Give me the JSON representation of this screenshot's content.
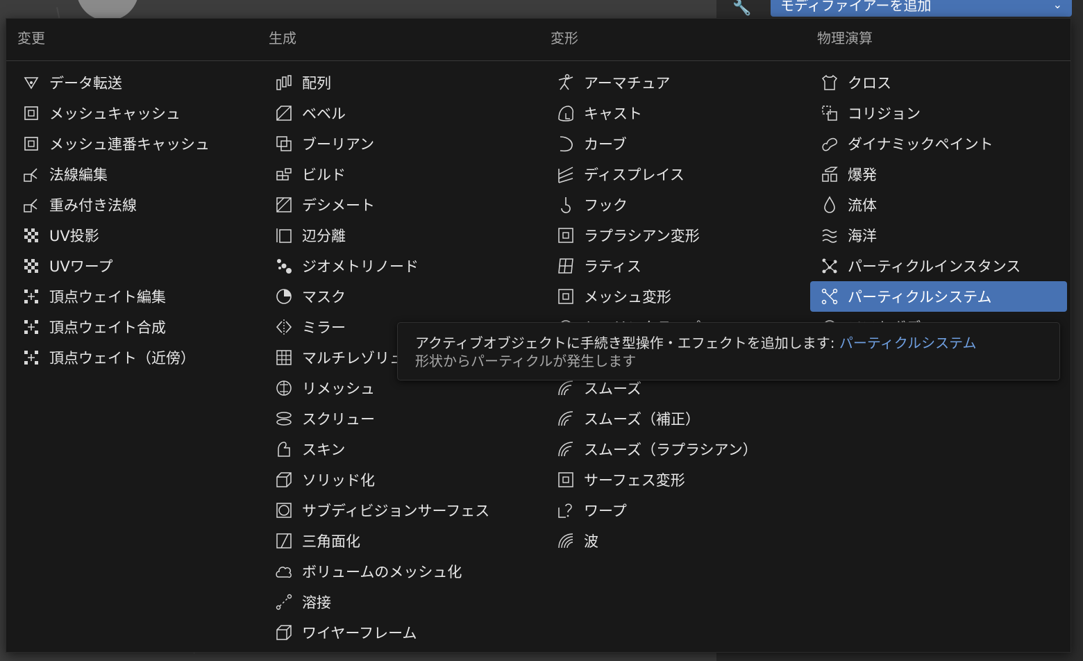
{
  "header_dropdown": {
    "label": "モディファイアーを追加"
  },
  "columns": [
    {
      "title": "変更",
      "items": [
        {
          "label": "データ転送",
          "icon": "data-transfer-icon"
        },
        {
          "label": "メッシュキャッシュ",
          "icon": "mesh-cache-icon"
        },
        {
          "label": "メッシュ連番キャッシュ",
          "icon": "mesh-sequence-cache-icon"
        },
        {
          "label": "法線編集",
          "icon": "normal-edit-icon"
        },
        {
          "label": "重み付き法線",
          "icon": "weighted-normal-icon"
        },
        {
          "label": "UV投影",
          "icon": "uv-project-icon"
        },
        {
          "label": "UVワープ",
          "icon": "uv-warp-icon"
        },
        {
          "label": "頂点ウェイト編集",
          "icon": "vertex-weight-icon"
        },
        {
          "label": "頂点ウェイト合成",
          "icon": "vertex-weight-icon"
        },
        {
          "label": "頂点ウェイト（近傍）",
          "icon": "vertex-weight-icon"
        }
      ]
    },
    {
      "title": "生成",
      "items": [
        {
          "label": "配列",
          "icon": "array-icon"
        },
        {
          "label": "ベベル",
          "icon": "bevel-icon"
        },
        {
          "label": "ブーリアン",
          "icon": "boolean-icon"
        },
        {
          "label": "ビルド",
          "icon": "build-icon"
        },
        {
          "label": "デシメート",
          "icon": "decimate-icon"
        },
        {
          "label": "辺分離",
          "icon": "edge-split-icon"
        },
        {
          "label": "ジオメトリノード",
          "icon": "geometry-nodes-icon"
        },
        {
          "label": "マスク",
          "icon": "mask-icon"
        },
        {
          "label": "ミラー",
          "icon": "mirror-icon"
        },
        {
          "label": "マルチレゾリューション",
          "icon": "multires-icon"
        },
        {
          "label": "リメッシュ",
          "icon": "remesh-icon"
        },
        {
          "label": "スクリュー",
          "icon": "screw-icon"
        },
        {
          "label": "スキン",
          "icon": "skin-icon"
        },
        {
          "label": "ソリッド化",
          "icon": "solidify-icon"
        },
        {
          "label": "サブディビジョンサーフェス",
          "icon": "subdivision-icon"
        },
        {
          "label": "三角面化",
          "icon": "triangulate-icon"
        },
        {
          "label": "ボリュームのメッシュ化",
          "icon": "volume-to-mesh-icon"
        },
        {
          "label": "溶接",
          "icon": "weld-icon"
        },
        {
          "label": "ワイヤーフレーム",
          "icon": "wireframe-icon"
        }
      ]
    },
    {
      "title": "変形",
      "items": [
        {
          "label": "アーマチュア",
          "icon": "armature-icon"
        },
        {
          "label": "キャスト",
          "icon": "cast-icon"
        },
        {
          "label": "カーブ",
          "icon": "curve-icon"
        },
        {
          "label": "ディスプレイス",
          "icon": "displace-icon"
        },
        {
          "label": "フック",
          "icon": "hook-icon"
        },
        {
          "label": "ラプラシアン変形",
          "icon": "laplacian-deform-icon"
        },
        {
          "label": "ラティス",
          "icon": "lattice-icon"
        },
        {
          "label": "メッシュ変形",
          "icon": "mesh-deform-icon"
        },
        {
          "label": "シュリンクラップ",
          "icon": "shrinkwrap-icon"
        },
        {
          "label": "",
          "icon": ""
        },
        {
          "label": "スムーズ",
          "icon": "smooth-icon"
        },
        {
          "label": "スムーズ（補正）",
          "icon": "smooth-icon"
        },
        {
          "label": "スムーズ（ラプラシアン）",
          "icon": "smooth-icon"
        },
        {
          "label": "サーフェス変形",
          "icon": "surface-deform-icon"
        },
        {
          "label": "ワープ",
          "icon": "warp-icon"
        },
        {
          "label": "波",
          "icon": "wave-icon"
        }
      ]
    },
    {
      "title": "物理演算",
      "items": [
        {
          "label": "クロス",
          "icon": "cloth-icon"
        },
        {
          "label": "コリジョン",
          "icon": "collision-icon"
        },
        {
          "label": "ダイナミックペイント",
          "icon": "dynamic-paint-icon"
        },
        {
          "label": "爆発",
          "icon": "explode-icon"
        },
        {
          "label": "流体",
          "icon": "fluid-icon"
        },
        {
          "label": "海洋",
          "icon": "ocean-icon"
        },
        {
          "label": "パーティクルインスタンス",
          "icon": "particle-instance-icon"
        },
        {
          "label": "パーティクルシステム",
          "icon": "particle-system-icon"
        },
        {
          "label": "ソフトボディ",
          "icon": "softbody-icon"
        }
      ]
    }
  ],
  "tooltip": {
    "description": "アクティブオブジェクトに手続き型操作・エフェクトを追加します:",
    "highlight": "パーティクルシステム",
    "sub": "形状からパーティクルが発生します"
  },
  "colors": {
    "menu_bg": "#181818",
    "active_bg": "#4772b3",
    "tooltip_highlight": "#6f9fe0"
  }
}
